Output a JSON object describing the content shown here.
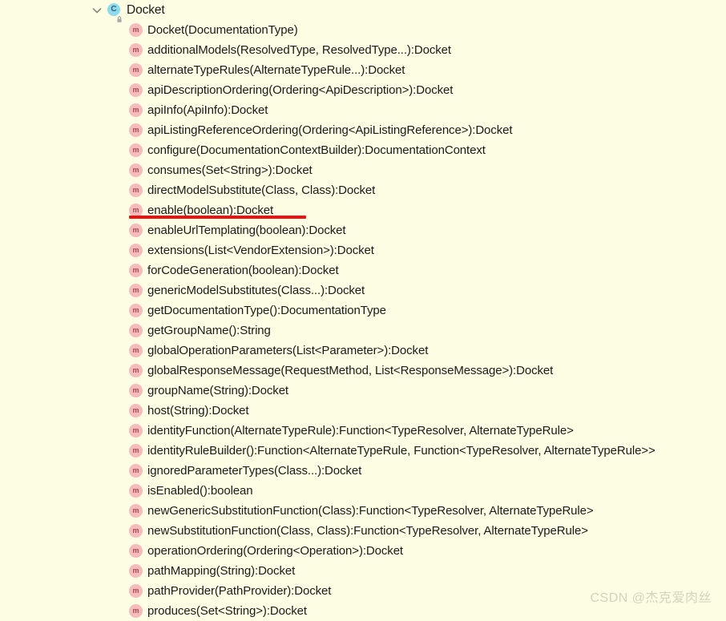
{
  "view": {
    "name": "structure-tree",
    "background_color": "#fdfde3",
    "text_color": "#1b1b1b"
  },
  "icons": {
    "expanded_chevron": "chevron-down-icon",
    "class_icon": "class-icon",
    "class_icon_glyph": "C",
    "class_icon_color": "#8edbef",
    "lock_icon": "lock-icon",
    "method_icon": "method-icon",
    "method_icon_glyph": "m",
    "method_icon_color": "#f6bcbc"
  },
  "tree": {
    "root": {
      "label": "Docket",
      "kind": "class",
      "expanded": true
    },
    "members": [
      {
        "label": "Docket(DocumentationType)",
        "kind": "method"
      },
      {
        "label": "additionalModels(ResolvedType, ResolvedType...):Docket",
        "kind": "method"
      },
      {
        "label": "alternateTypeRules(AlternateTypeRule...):Docket",
        "kind": "method"
      },
      {
        "label": "apiDescriptionOrdering(Ordering<ApiDescription>):Docket",
        "kind": "method"
      },
      {
        "label": "apiInfo(ApiInfo):Docket",
        "kind": "method"
      },
      {
        "label": "apiListingReferenceOrdering(Ordering<ApiListingReference>):Docket",
        "kind": "method"
      },
      {
        "label": "configure(DocumentationContextBuilder):DocumentationContext",
        "kind": "method"
      },
      {
        "label": "consumes(Set<String>):Docket",
        "kind": "method"
      },
      {
        "label": "directModelSubstitute(Class, Class):Docket",
        "kind": "method"
      },
      {
        "label": "enable(boolean):Docket",
        "kind": "method",
        "annotated": true
      },
      {
        "label": "enableUrlTemplating(boolean):Docket",
        "kind": "method"
      },
      {
        "label": "extensions(List<VendorExtension>):Docket",
        "kind": "method"
      },
      {
        "label": "forCodeGeneration(boolean):Docket",
        "kind": "method"
      },
      {
        "label": "genericModelSubstitutes(Class...):Docket",
        "kind": "method"
      },
      {
        "label": "getDocumentationType():DocumentationType",
        "kind": "method"
      },
      {
        "label": "getGroupName():String",
        "kind": "method"
      },
      {
        "label": "globalOperationParameters(List<Parameter>):Docket",
        "kind": "method"
      },
      {
        "label": "globalResponseMessage(RequestMethod, List<ResponseMessage>):Docket",
        "kind": "method"
      },
      {
        "label": "groupName(String):Docket",
        "kind": "method"
      },
      {
        "label": "host(String):Docket",
        "kind": "method"
      },
      {
        "label": "identityFunction(AlternateTypeRule):Function<TypeResolver, AlternateTypeRule>",
        "kind": "method"
      },
      {
        "label": "identityRuleBuilder():Function<AlternateTypeRule, Function<TypeResolver, AlternateTypeRule>>",
        "kind": "method"
      },
      {
        "label": "ignoredParameterTypes(Class...):Docket",
        "kind": "method"
      },
      {
        "label": "isEnabled():boolean",
        "kind": "method"
      },
      {
        "label": "newGenericSubstitutionFunction(Class):Function<TypeResolver, AlternateTypeRule>",
        "kind": "method"
      },
      {
        "label": "newSubstitutionFunction(Class, Class):Function<TypeResolver, AlternateTypeRule>",
        "kind": "method"
      },
      {
        "label": "operationOrdering(Ordering<Operation>):Docket",
        "kind": "method"
      },
      {
        "label": "pathMapping(String):Docket",
        "kind": "method"
      },
      {
        "label": "pathProvider(PathProvider):Docket",
        "kind": "method"
      },
      {
        "label": "produces(Set<String>):Docket",
        "kind": "method"
      }
    ]
  },
  "annotation": {
    "type": "underline",
    "color": "#ee1111",
    "target_label": "enable(boolean):Docket"
  },
  "watermark": {
    "text": "CSDN @杰克爱肉丝",
    "color": "#d3d3bd"
  }
}
